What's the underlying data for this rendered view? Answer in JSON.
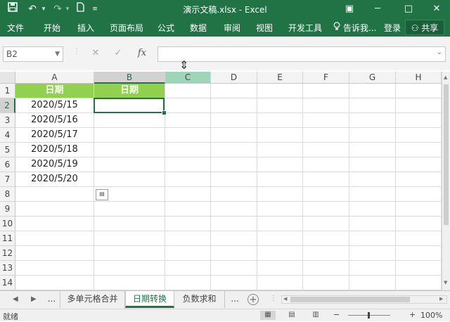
{
  "title": "演示文稿.xlsx - Excel",
  "quick_access": {
    "save_icon": "save-icon",
    "undo_icon": "undo-icon",
    "redo_icon": "redo-icon",
    "new_icon": "new-file-icon",
    "customize_icon": "customize-icon"
  },
  "window_controls": {
    "ribbon_display": "▣",
    "minimize": "─",
    "maximize": "□",
    "close": "✕"
  },
  "ribbon": {
    "tabs": [
      "文件",
      "开始",
      "插入",
      "页面布局",
      "公式",
      "数据",
      "审阅",
      "视图",
      "开发工具"
    ],
    "tell_me": "告诉我...",
    "login": "登录",
    "share": "共享"
  },
  "formula_bar": {
    "name_box": "B2",
    "cancel": "✕",
    "enter": "✓",
    "fx": "fx",
    "value": ""
  },
  "columns": [
    "A",
    "B",
    "C",
    "D",
    "E",
    "F",
    "G",
    "H"
  ],
  "rows": [
    "1",
    "2",
    "3",
    "4",
    "5",
    "6",
    "7",
    "8",
    "9",
    "10",
    "11",
    "12",
    "13",
    "14"
  ],
  "cells": {
    "A1": "日期",
    "B1": "日期",
    "A_dates": [
      "2020/5/15",
      "2020/5/16",
      "2020/5/17",
      "2020/5/18",
      "2020/5/19",
      "2020/5/20"
    ]
  },
  "sheet_tabs": {
    "more_left": "...",
    "tabs": [
      "多单元格合并",
      "日期转换",
      "负数求和"
    ],
    "active": "日期转换",
    "more_right": "...",
    "add": "+"
  },
  "status": {
    "ready": "就绪",
    "zoom": "100%",
    "minus": "−",
    "plus": "+"
  },
  "colors": {
    "excel_green": "#217346",
    "header_fill": "#92d050"
  }
}
